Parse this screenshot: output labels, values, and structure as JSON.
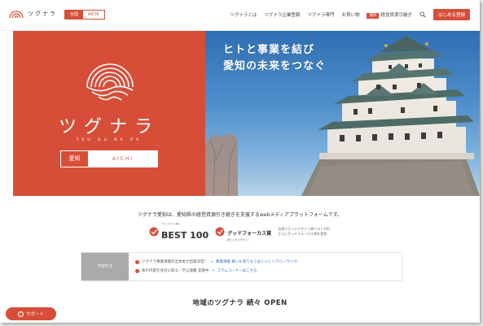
{
  "header": {
    "logo_text": "ツグナラ",
    "region_tabs": [
      "全国",
      "AICHI"
    ],
    "nav": [
      "ツグナラとは",
      "ツグナラ企業登録",
      "ツグナラ専門",
      "お買い物",
      "経営資源引継ぎ"
    ],
    "nav_badge": "無料",
    "cta_label": "はじめる登録"
  },
  "hero": {
    "tagline_1": "ヒトと事業を結び",
    "tagline_2": "愛知の未来をつなぐ",
    "brand_kata": "ツグナラ",
    "brand_roma": "TSU GU NA RA",
    "pref_jp": "愛知",
    "pref_en": "AICHI",
    "brand_color": "#d74e38"
  },
  "main": {
    "description": "ツグナラ愛知は、愛知県の経営資源引き継ぎを支援するwebメディアプラットフォームです。",
    "award_best_sub": "ベストデザイン選出",
    "award_best": "BEST 100",
    "award_gf": "グッドフォーカス賞",
    "award_gf_sub": "新ビジネスデザイン",
    "award_note_1": "全国でグッドデザイン賞ベスト100",
    "award_note_2": "さらにグッドフォーカス賞を受賞",
    "topics_label": "TOPICS",
    "topics": [
      {
        "text": "ツグナラ事業承継の全体本が出版決定！",
        "link": "事業承継 買いも売りもうまくいくリアルノウハウ"
      },
      {
        "text": "本の内容を身近に知る・学ぶ連載 実施中",
        "link": "コラムコーナーはこちら"
      }
    ],
    "open_heading": "地域のツグナラ 続々 OPEN"
  },
  "support": {
    "label": "サポート"
  }
}
